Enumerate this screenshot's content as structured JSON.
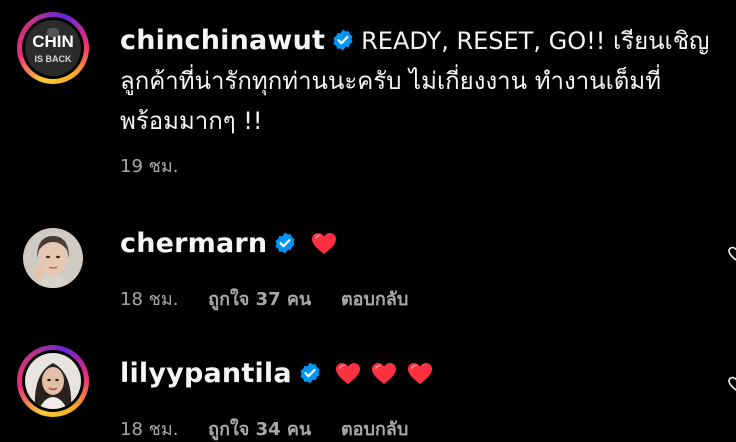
{
  "comments": [
    {
      "username": "chinchinawut",
      "verified": true,
      "text_lines": [
        "READY, RESET, GO!! เรียนเชิญ",
        "ลูกค้าที่น่ารักทุกท่านนะครับ ไม่เกี่ยงงาน ทำงานเต็มที่",
        "พร้อมมากๆ !!"
      ],
      "time": "19 ชม.",
      "avatar_icon": "chin-is-back-avatar"
    },
    {
      "username": "chermarn",
      "verified": true,
      "hearts": 1,
      "time": "18 ชม.",
      "likes": "ถูกใจ 37 คน",
      "reply": "ตอบกลับ",
      "avatar_icon": "woman-portrait-avatar"
    },
    {
      "username": "lilyypantila",
      "verified": true,
      "hearts": 3,
      "time": "18 ชม.",
      "likes": "ถูกใจ 34 คน",
      "reply": "ตอบกลับ",
      "avatar_icon": "woman-portrait-avatar"
    }
  ],
  "colors": {
    "background": "#000000",
    "text": "#f5f5f5",
    "meta": "#a8a8a8",
    "verified": "#0095f6",
    "heart": "#ff3040"
  }
}
